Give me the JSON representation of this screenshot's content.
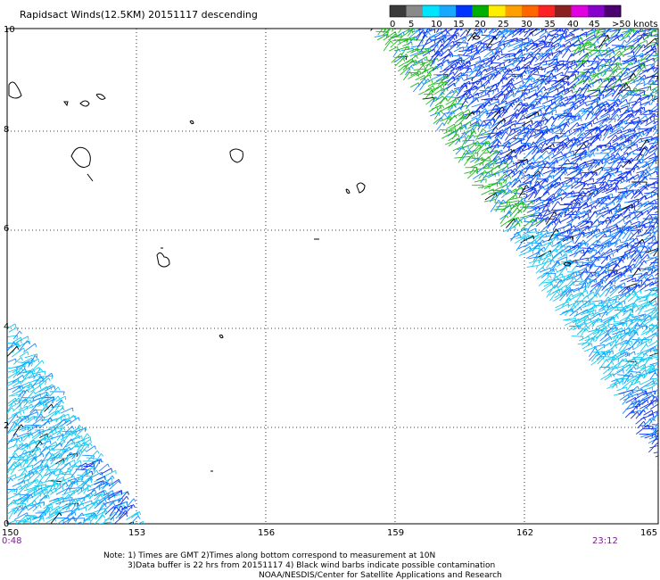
{
  "title": "Rapidsact Winds(12.5KM) 20151117 descending",
  "legend": {
    "ticks": [
      "0",
      "5",
      "10",
      "15",
      "20",
      "25",
      "30",
      "35",
      "40",
      "45",
      ">50 knots"
    ],
    "colors": [
      "#3a3a3a",
      "#8a8a8a",
      "#00e5ff",
      "#19a8ff",
      "#0033ff",
      "#00b000",
      "#ffee00",
      "#ffa000",
      "#ff6600",
      "#ff2222",
      "#8b2020",
      "#e000e0",
      "#8800cc",
      "#4b0070"
    ]
  },
  "axes": {
    "x_ticks": [
      "150",
      "153",
      "156",
      "159",
      "162",
      "165"
    ],
    "y_ticks": [
      "10",
      "8",
      "6",
      "4",
      "2",
      "0"
    ]
  },
  "times": {
    "left": "0:48",
    "right": "23:12"
  },
  "notes": [
    "Note: 1) Times are GMT 2)Times along bottom correspond to measurement at 10N",
    "3)Data buffer is 22 hrs from 20151117 4) Black wind barbs indicate possible contamination",
    "NOAA/NESDIS/Center for Satellite Applications and Research"
  ],
  "swaths": [
    {
      "name": "east-swath",
      "bands": [
        "green",
        "blue",
        "cyan"
      ]
    },
    {
      "name": "west-swath",
      "bands": [
        "cyan",
        "blue"
      ]
    }
  ],
  "grid": "dotted"
}
